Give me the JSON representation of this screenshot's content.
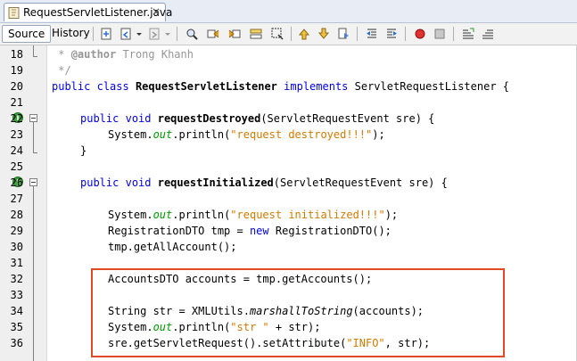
{
  "tab": {
    "title": "RequestServletListener.java",
    "close": "×",
    "icon": "java-file-icon"
  },
  "toolbar": {
    "source_label": "Source",
    "history_label": "History",
    "icons": [
      "last-edit-icon",
      "back-icon",
      "forward-icon",
      "find-selection-icon",
      "find-previous-icon",
      "find-next-icon",
      "toggle-highlight-icon",
      "toggle-rect-selection-icon",
      "previous-bookmark-icon",
      "next-bookmark-icon",
      "toggle-bookmark-icon",
      "shift-left-icon",
      "shift-right-icon",
      "start-macro-icon",
      "stop-macro-icon",
      "comment-icon",
      "uncomment-icon"
    ]
  },
  "colors": {
    "keyword": "#0000e6",
    "string": "#ce7b00",
    "comment": "#969696",
    "field": "#009900",
    "highlight_box": "#e04a25"
  },
  "lines": [
    {
      "num": "18"
    },
    {
      "num": "19"
    },
    {
      "num": "20"
    },
    {
      "num": "21"
    },
    {
      "num": "22"
    },
    {
      "num": "23"
    },
    {
      "num": "24"
    },
    {
      "num": "25"
    },
    {
      "num": "26"
    },
    {
      "num": "27"
    },
    {
      "num": "28"
    },
    {
      "num": "29"
    },
    {
      "num": "30"
    },
    {
      "num": "31"
    },
    {
      "num": "32"
    },
    {
      "num": "33"
    },
    {
      "num": "34"
    },
    {
      "num": "35"
    },
    {
      "num": "36"
    }
  ],
  "code": {
    "l18a": " * ",
    "l18b": "@author",
    "l18c": " Trong Khanh",
    "l19": " */",
    "l20_public": "public",
    "l20_class": "class",
    "l20_name": "RequestServletListener",
    "l20_impl": "implements",
    "l20_rest": " ServletRequestListener {",
    "l22_public": "public",
    "l22_void": "void",
    "l22_name": "requestDestroyed",
    "l22_rest": "(ServletRequestEvent sre) {",
    "l23_sys": "System.",
    "l23_out": "out",
    "l23_println": ".println(",
    "l23_str": "\"request destroyed!!!\"",
    "l23_end": ");",
    "l24": "}",
    "l26_public": "public",
    "l26_void": "void",
    "l26_name": "requestInitialized",
    "l26_rest": "(ServletRequestEvent sre) {",
    "l28_sys": "System.",
    "l28_out": "out",
    "l28_println": ".println(",
    "l28_str": "\"request initialized!!!\"",
    "l28_end": ");",
    "l29_a": "RegistrationDTO tmp = ",
    "l29_new": "new",
    "l29_b": " RegistrationDTO();",
    "l30": "tmp.getAllAccount();",
    "l32": "AccountsDTO accounts = tmp.getAccounts();",
    "l34_a": "String str = XMLUtils.",
    "l34_m": "marshallToString",
    "l34_b": "(accounts);",
    "l35_sys": "System.",
    "l35_out": "out",
    "l35_println": ".println(",
    "l35_str": "\"str \"",
    "l35_end": " + str);",
    "l36_a": "sre.getServletRequest().setAttribute(",
    "l36_str": "\"INFO\"",
    "l36_b": ", str);"
  }
}
